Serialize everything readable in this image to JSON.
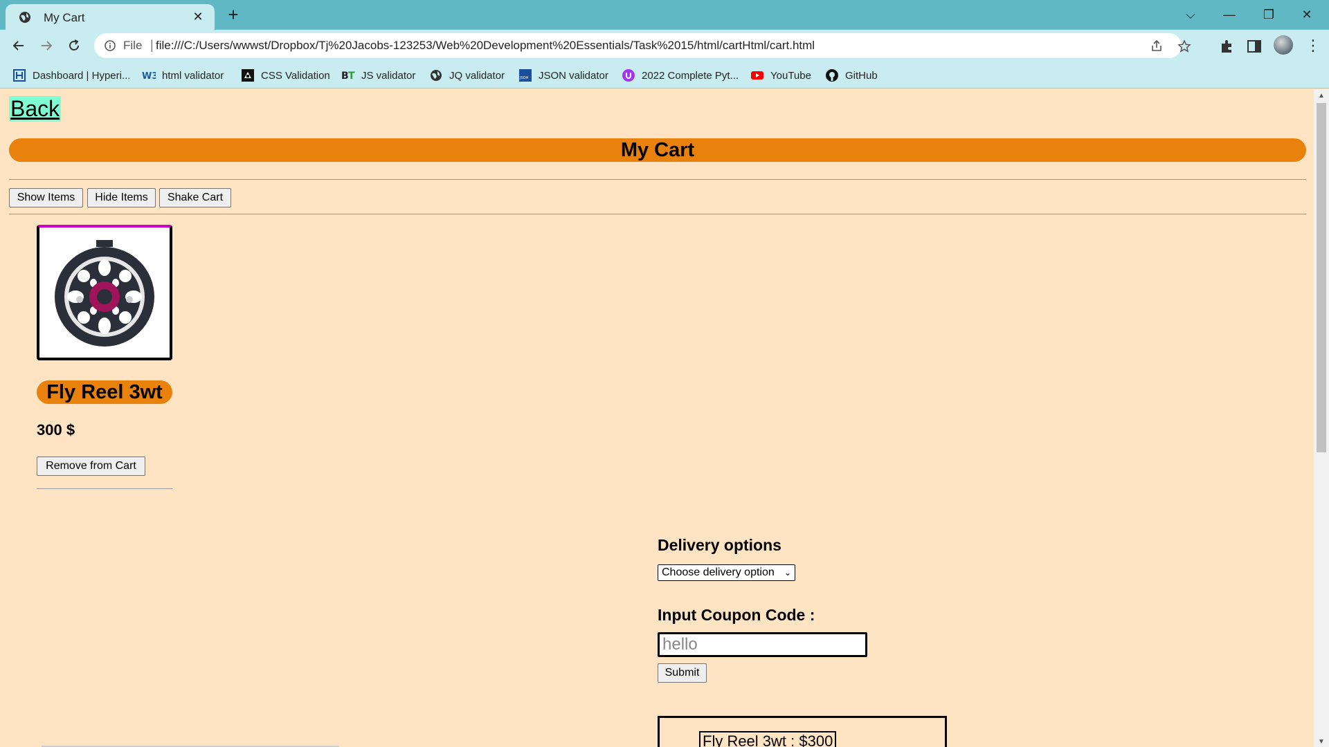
{
  "browser": {
    "tab": {
      "title": "My Cart"
    },
    "omnibox": {
      "scheme": "File",
      "url": "file:///C:/Users/wwwst/Dropbox/Tj%20Jacobs-123253/Web%20Development%20Essentials/Task%2015/html/cartHtml/cart.html"
    },
    "bookmarks": [
      {
        "label": "Dashboard | Hyperi...",
        "icon": "hyperion-icon"
      },
      {
        "label": "html validator",
        "icon": "w3c-icon"
      },
      {
        "label": "CSS Validation",
        "icon": "css-validator-icon"
      },
      {
        "label": "JS validator",
        "icon": "bt-icon"
      },
      {
        "label": "JQ validator",
        "icon": "globe-icon"
      },
      {
        "label": "JSON validator",
        "icon": "json-icon"
      },
      {
        "label": "2022 Complete Pyt...",
        "icon": "udemy-icon"
      },
      {
        "label": "YouTube",
        "icon": "youtube-icon"
      },
      {
        "label": "GitHub",
        "icon": "github-icon"
      }
    ]
  },
  "page": {
    "back_link": "Back",
    "title": "My Cart",
    "buttons": {
      "show": "Show Items",
      "hide": "Hide Items",
      "shake": "Shake Cart"
    },
    "product": {
      "name": "Fly Reel 3wt",
      "price": "300 $",
      "remove_label": "Remove from Cart"
    },
    "delivery": {
      "heading": "Delivery options",
      "selected": "Choose delivery option"
    },
    "coupon": {
      "heading": "Input Coupon Code :",
      "value": "hello",
      "submit_label": "Submit"
    },
    "summary": {
      "item": "Fly Reel 3wt : $300"
    }
  },
  "colors": {
    "page_bg": "#ffe4c4",
    "accent_orange": "#e8820c",
    "back_highlight": "#7fffd4",
    "tab_strip": "#5fb8c4",
    "toolbar": "#c9ecf0"
  }
}
